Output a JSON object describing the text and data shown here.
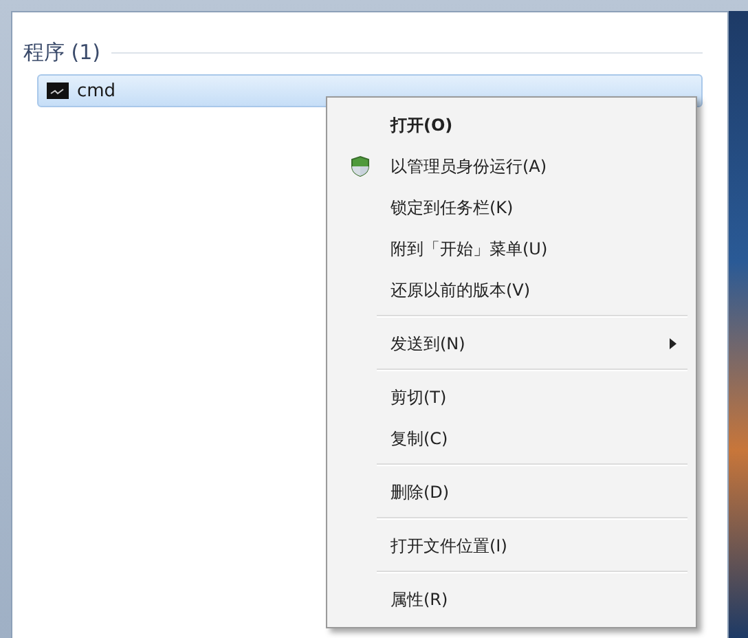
{
  "section": {
    "title": "程序 (1)"
  },
  "results": [
    {
      "label": "cmd",
      "selected": true
    }
  ],
  "context_menu": {
    "groups": [
      [
        {
          "label": "打开(O)",
          "default": true,
          "kind": "plain",
          "submenu": false
        },
        {
          "label": "以管理员身份运行(A)",
          "default": false,
          "kind": "elevated",
          "submenu": false
        },
        {
          "label": "锁定到任务栏(K)",
          "default": false,
          "kind": "plain",
          "submenu": false
        },
        {
          "label": "附到「开始」菜单(U)",
          "default": false,
          "kind": "plain",
          "submenu": false
        },
        {
          "label": "还原以前的版本(V)",
          "default": false,
          "kind": "plain",
          "submenu": false
        }
      ],
      [
        {
          "label": "发送到(N)",
          "default": false,
          "kind": "plain",
          "submenu": true
        }
      ],
      [
        {
          "label": "剪切(T)",
          "default": false,
          "kind": "plain",
          "submenu": false
        },
        {
          "label": "复制(C)",
          "default": false,
          "kind": "plain",
          "submenu": false
        }
      ],
      [
        {
          "label": "删除(D)",
          "default": false,
          "kind": "plain",
          "submenu": false
        }
      ],
      [
        {
          "label": "打开文件位置(I)",
          "default": false,
          "kind": "plain",
          "submenu": false
        }
      ],
      [
        {
          "label": "属性(R)",
          "default": false,
          "kind": "plain",
          "submenu": false
        }
      ]
    ]
  }
}
